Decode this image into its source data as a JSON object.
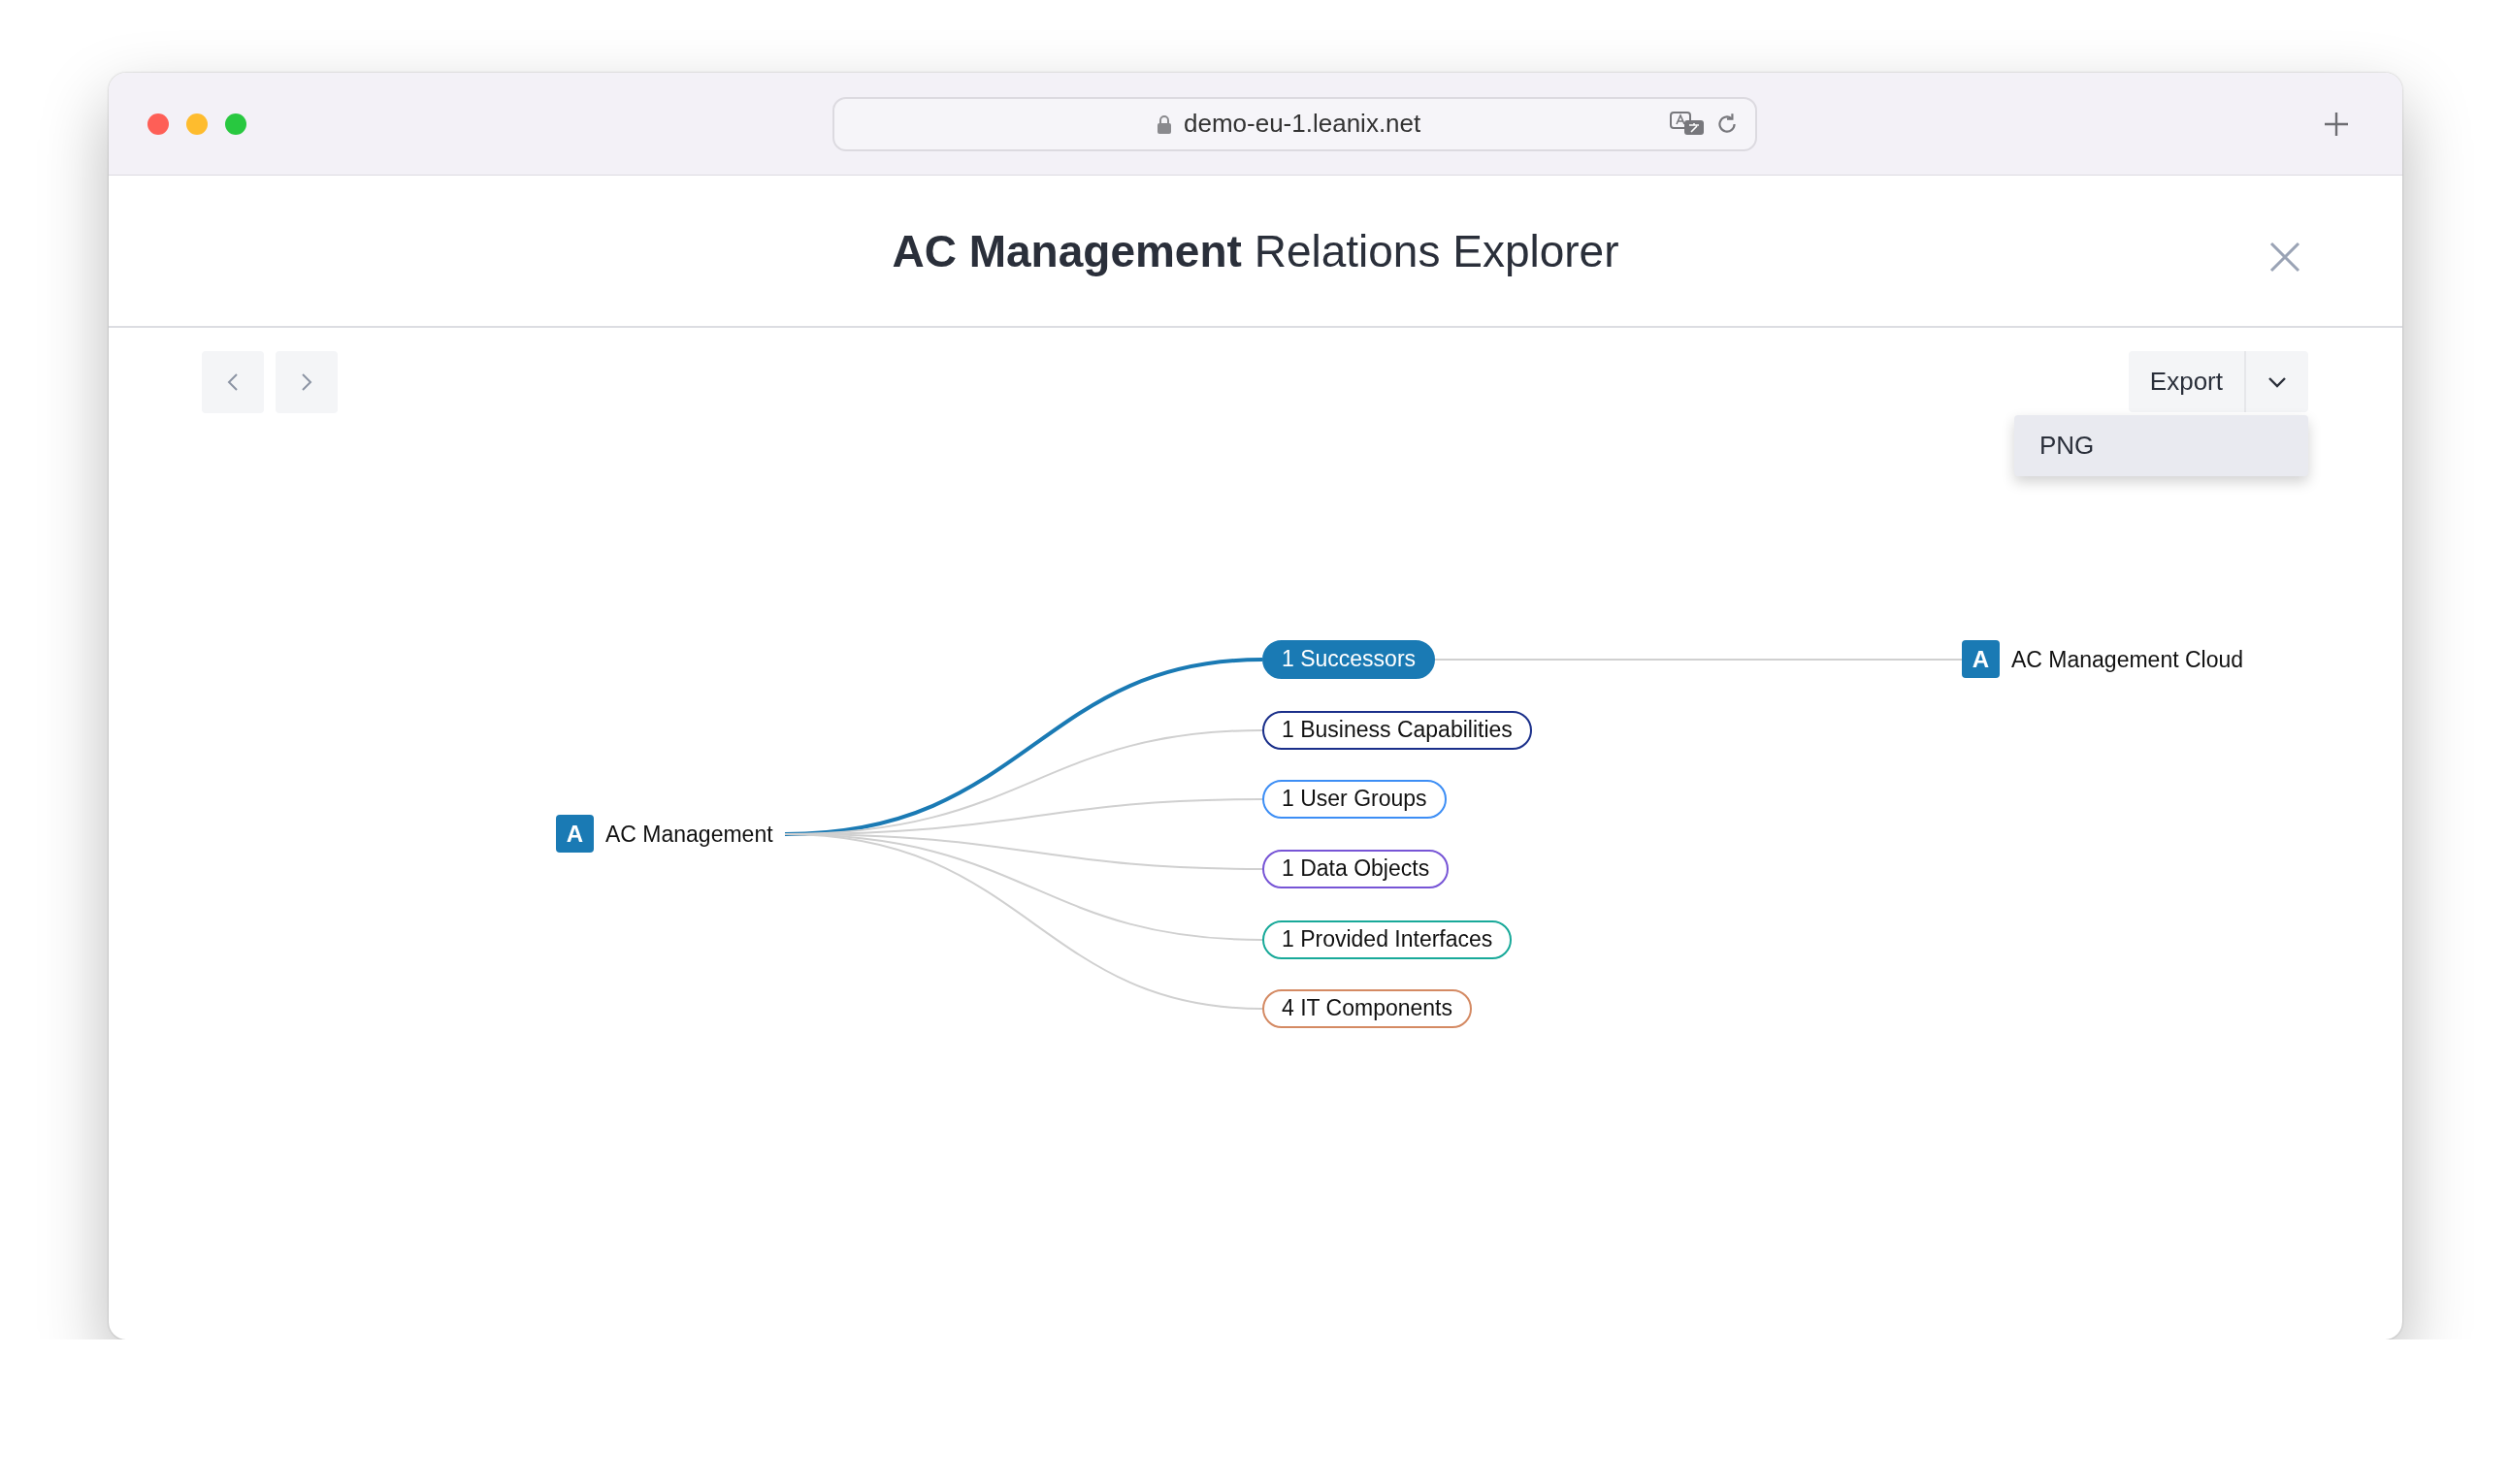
{
  "browser": {
    "url": "demo-eu-1.leanix.net"
  },
  "header": {
    "title": "**AC Management** Relations Explorer"
  },
  "toolbar": {
    "export": {
      "label": "Export",
      "expanded": true
    },
    "menu": [
      "PNG"
    ]
  },
  "graph": {
    "root": {
      "icon": "A",
      "label": "AC Management"
    },
    "relations": [
      {
        "label": "1 Successors",
        "color": "#1a7ab4",
        "selected": true,
        "target": {
          "icon": "A",
          "label": "AC Management Cloud"
        }
      },
      {
        "label": "1 Business Capabilities",
        "color": "#1a2f8a",
        "selected": false
      },
      {
        "label": "1 User Groups",
        "color": "#3d8ef5",
        "selected": false
      },
      {
        "label": "1 Data Objects",
        "color": "#7755d6",
        "selected": false
      },
      {
        "label": "1 Provided Interfaces",
        "color": "#18a999",
        "selected": false
      },
      {
        "label": "4 IT Components",
        "color": "#d48a63",
        "selected": false
      }
    ]
  }
}
